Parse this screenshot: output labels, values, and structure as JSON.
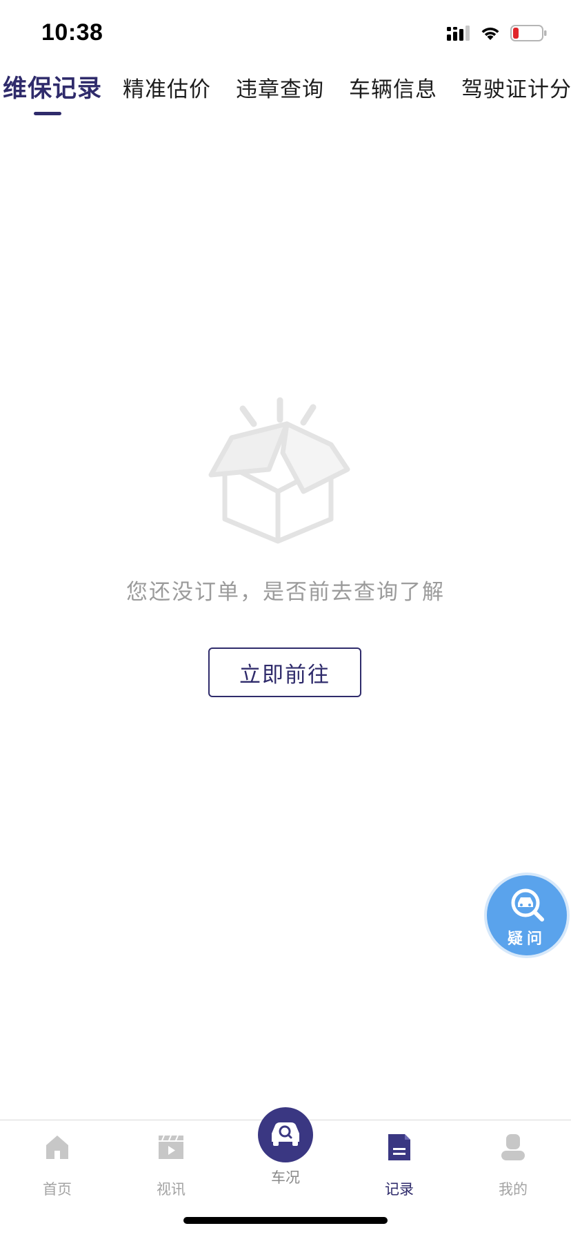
{
  "status_bar": {
    "time": "10:38"
  },
  "tabs": [
    {
      "label": "维保记录",
      "active": true
    },
    {
      "label": "精准估价",
      "active": false
    },
    {
      "label": "违章查询",
      "active": false
    },
    {
      "label": "车辆信息",
      "active": false
    },
    {
      "label": "驾驶证计分",
      "active": false
    }
  ],
  "empty_state": {
    "message": "您还没订单，是否前去查询了解",
    "button_label": "立即前往"
  },
  "help_fab": {
    "label": "疑问"
  },
  "bottom_nav": {
    "items": [
      {
        "label": "首页",
        "icon": "home-icon"
      },
      {
        "label": "视讯",
        "icon": "video-icon"
      },
      {
        "label": "车况",
        "icon": "car-search-icon"
      },
      {
        "label": "记录",
        "icon": "document-icon",
        "active": true
      },
      {
        "label": "我的",
        "icon": "user-icon"
      }
    ]
  },
  "colors": {
    "accent": "#2f2b6b",
    "fab": "#5aa3ec",
    "muted_text": "#9b9b9b"
  }
}
